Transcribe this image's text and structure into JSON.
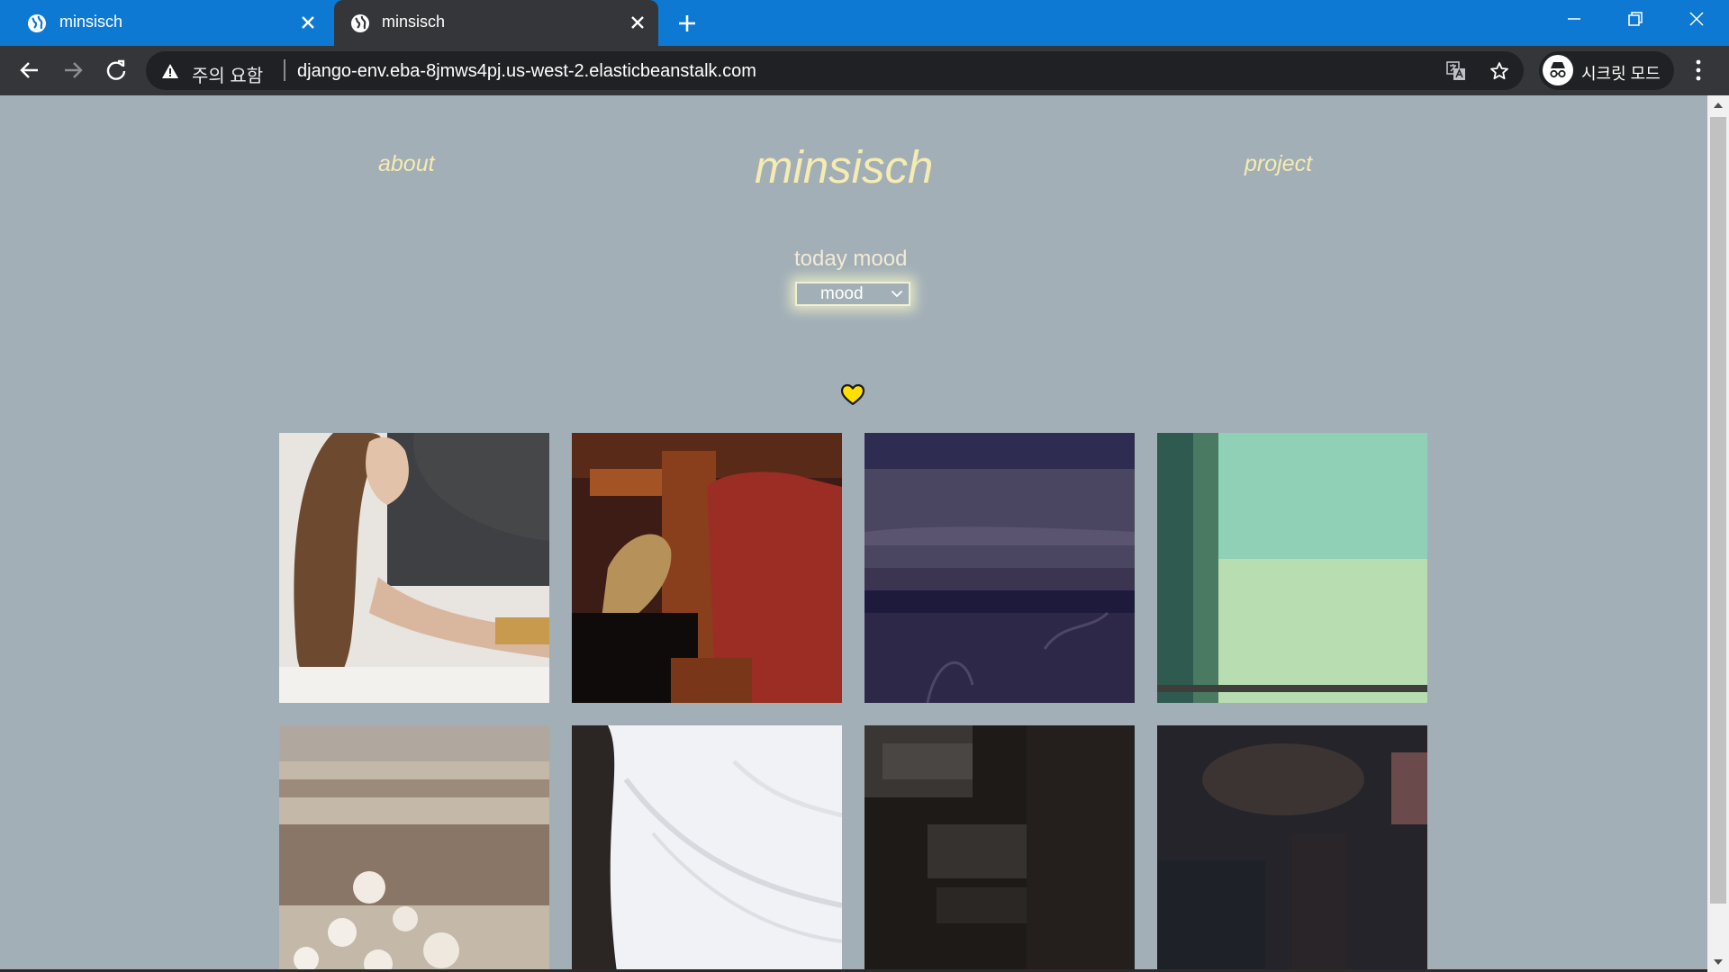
{
  "browser": {
    "tabs": [
      {
        "title": "minsisch",
        "active": false,
        "icon": "globe-icon"
      },
      {
        "title": "minsisch",
        "active": true,
        "icon": "globe-icon"
      }
    ],
    "address_bar": {
      "security_warning": "주의 요함",
      "url": "django-env.eba-8jmws4pj.us-west-2.elasticbeanstalk.com"
    },
    "incognito_label": "시크릿 모드",
    "colors": {
      "titlebar": "#0d79d2",
      "toolbar": "#35363a",
      "omnibox": "#202124"
    }
  },
  "page": {
    "nav": {
      "about": "about",
      "project": "project"
    },
    "title": "minsisch",
    "mood": {
      "label": "today mood",
      "selected": "mood"
    },
    "heart_icon": "heart-icon",
    "colors": {
      "background": "#a2afb7",
      "accent": "#f6ebb0",
      "heart": "#ffe000"
    },
    "gallery": [
      {
        "alt": "woman with long brown hair in dark t-shirt"
      },
      {
        "alt": "red pillow and straw hat"
      },
      {
        "alt": "dark purple fabric"
      },
      {
        "alt": "teal and pale green wall"
      },
      {
        "alt": "blurred white blossoms"
      },
      {
        "alt": "white shirt sleeve"
      },
      {
        "alt": "dark shadowed interior"
      },
      {
        "alt": "blurred dark scene"
      }
    ]
  }
}
